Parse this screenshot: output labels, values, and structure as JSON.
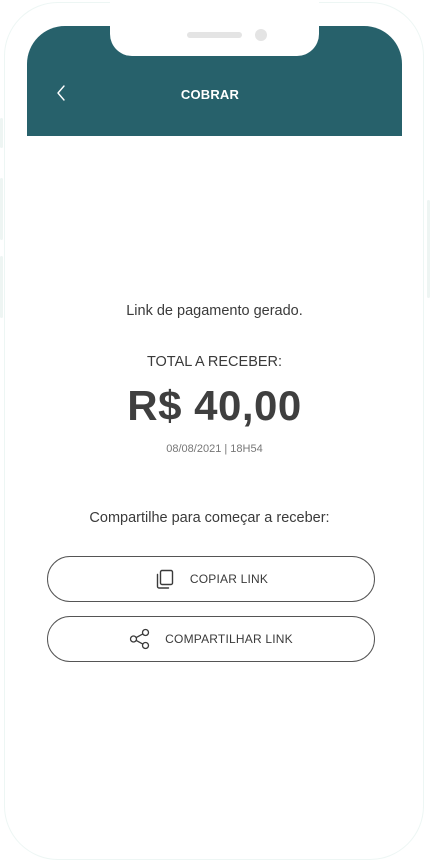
{
  "header": {
    "title": "COBRAR",
    "color": "#27616b"
  },
  "icons": {
    "back": "chevron-left-icon",
    "copy": "copy-icon",
    "share": "share-icon"
  },
  "content": {
    "generated_text": "Link de pagamento gerado.",
    "total_label": "TOTAL A RECEBER:",
    "amount": "R$ 40,00",
    "datetime": "08/08/2021 | 18H54",
    "share_prompt": "Compartilhe para começar a receber:"
  },
  "actions": {
    "copy_label": "COPIAR LINK",
    "share_label": "COMPARTILHAR LINK"
  }
}
